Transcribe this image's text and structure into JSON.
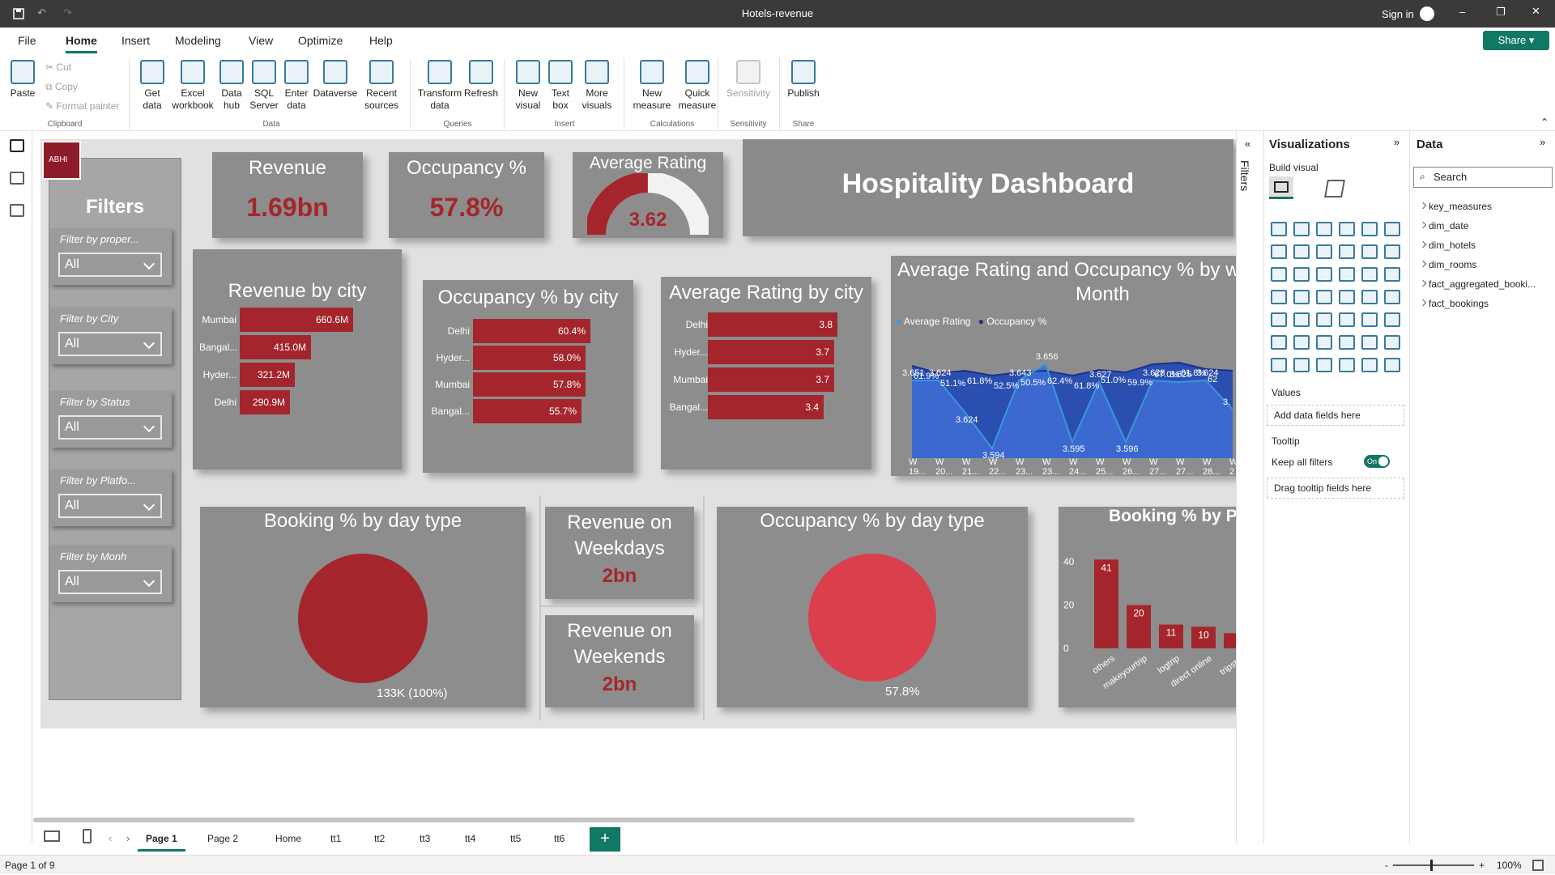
{
  "app": {
    "title": "Hotels-revenue",
    "signin": "Sign in",
    "share": "Share"
  },
  "menu": [
    "File",
    "Home",
    "Insert",
    "Modeling",
    "View",
    "Optimize",
    "Help"
  ],
  "ribbon": {
    "clipboard": {
      "paste": "Paste",
      "cut": "Cut",
      "copy": "Copy",
      "format_painter": "Format painter",
      "group": "Clipboard"
    },
    "data": {
      "get_data": "Get data",
      "excel": "Excel workbook",
      "data_hub": "Data hub",
      "sql": "SQL Server",
      "enter": "Enter data",
      "dataverse": "Dataverse",
      "recent": "Recent sources",
      "group": "Data"
    },
    "queries": {
      "transform": "Transform data",
      "refresh": "Refresh",
      "group": "Queries"
    },
    "insert": {
      "new_visual": "New visual",
      "text_box": "Text box",
      "more_visuals": "More visuals",
      "group": "Insert"
    },
    "calculations": {
      "new_measure": "New measure",
      "quick_measure": "Quick measure",
      "group": "Calculations"
    },
    "sensitivity": {
      "label": "Sensitivity",
      "group": "Sensitivity"
    },
    "share": {
      "publish": "Publish",
      "group": "Share"
    }
  },
  "dashboard": {
    "logo": "ABHI",
    "filters_title": "Filters",
    "filters": [
      {
        "label": "Filter by proper...",
        "value": "All"
      },
      {
        "label": "Filter by City",
        "value": "All"
      },
      {
        "label": "Filter by Status",
        "value": "All"
      },
      {
        "label": "Filter by Platfo...",
        "value": "All"
      },
      {
        "label": "Filter by Monh",
        "value": "All"
      }
    ],
    "kpis": {
      "revenue": {
        "title": "Revenue",
        "value": "1.69bn"
      },
      "occupancy": {
        "title": "Occupancy %",
        "value": "57.8%"
      },
      "rating": {
        "title": "Average Rating",
        "value": "3.62",
        "fraction": 0.724
      }
    },
    "header_title": "Hospitality Dashboard",
    "revenue_weekdays": {
      "title": "Revenue on Weekdays",
      "value": "2bn"
    },
    "revenue_weekends": {
      "title": "Revenue on Weekends",
      "value": "2bn"
    },
    "booking_daytype": {
      "title": "Booking % by day type",
      "label": "133K (100%)"
    },
    "occupancy_daytype": {
      "title": "Occupancy % by day type",
      "label": "57.8%"
    }
  },
  "chart_data": [
    {
      "type": "bar",
      "title": "Revenue by city",
      "categories": [
        "Mumbai",
        "Bangal...",
        "Hyder...",
        "Delhi"
      ],
      "values": [
        660.6,
        415.0,
        321.2,
        290.9
      ],
      "labels": [
        "660.6M",
        "415.0M",
        "321.2M",
        "290.9M"
      ],
      "color": "#a4262c"
    },
    {
      "type": "bar",
      "title": "Occupancy % by city",
      "categories": [
        "Delhi",
        "Hyder...",
        "Mumbai",
        "Bangal..."
      ],
      "values": [
        60.4,
        58.0,
        57.8,
        55.7
      ],
      "labels": [
        "60.4%",
        "58.0%",
        "57.8%",
        "55.7%"
      ],
      "color": "#a4262c"
    },
    {
      "type": "bar",
      "title": "Average Rating by city",
      "categories": [
        "Delhi",
        "Hyder...",
        "Mumbai",
        "Bangal..."
      ],
      "values": [
        3.8,
        3.7,
        3.7,
        3.4
      ],
      "labels": [
        "3.8",
        "3.7",
        "3.7",
        "3.4"
      ],
      "color": "#a4262c"
    },
    {
      "type": "area",
      "title": "Average Rating and Occupancy % by we",
      "title2": "Month",
      "legend": [
        "Average Rating",
        "Occupancy %"
      ],
      "x": [
        "W 19...",
        "W 20...",
        "W 21...",
        "W 22...",
        "W 23...",
        "W 23...",
        "W 24...",
        "W 25...",
        "W 26...",
        "W 27...",
        "W 27...",
        "W 28...",
        "W 2"
      ],
      "series": [
        {
          "name": "Average Rating",
          "labels": [
            "3.651",
            "3.624",
            "3.624",
            "3.594",
            "3.643",
            "3.656",
            "3.595",
            "3.627",
            "3.596",
            "3.628",
            "3.625",
            "3.624",
            "3."
          ],
          "color": "#3a96dd"
        },
        {
          "name": "Occupancy %",
          "labels": [
            "61.9%",
            "51.1%",
            "61.8%",
            "52.5%",
            "50.5%",
            "62.4%",
            "61.8%",
            "51.0%",
            "59.9%",
            "67.0%",
            "61.8%",
            "62"
          ],
          "color": "#1e2f8c"
        }
      ]
    },
    {
      "type": "bar",
      "title": "Booking % by Pl",
      "categories": [
        "others",
        "makeyourtrip",
        "logtrip",
        "direct online",
        "tripster"
      ],
      "values": [
        41,
        20,
        11,
        10,
        7
      ],
      "labels": [
        "41",
        "20",
        "11",
        "10",
        ""
      ],
      "yticks": [
        "40",
        "20",
        "0"
      ],
      "color": "#a4262c"
    }
  ],
  "panes": {
    "filters_tab": "Filters",
    "viz_title": "Visualizations",
    "build_visual": "Build visual",
    "data_title": "Data",
    "search_placeholder": "Search",
    "values": "Values",
    "values_well": "Add data fields here",
    "tooltip": "Tooltip",
    "keep_filters": "Keep all filters",
    "toggle": "On",
    "tooltip_well": "Drag tooltip fields here",
    "tables": [
      "key_measures",
      "dim_date",
      "dim_hotels",
      "dim_rooms",
      "fact_aggregated_booki...",
      "fact_bookings"
    ]
  },
  "tabs": [
    "Page 1",
    "Page 2",
    "Home",
    "tt1",
    "tt2",
    "tt3",
    "tt4",
    "tt5",
    "tt6"
  ],
  "status": {
    "page": "Page 1 of 9",
    "zoom": "100%"
  }
}
